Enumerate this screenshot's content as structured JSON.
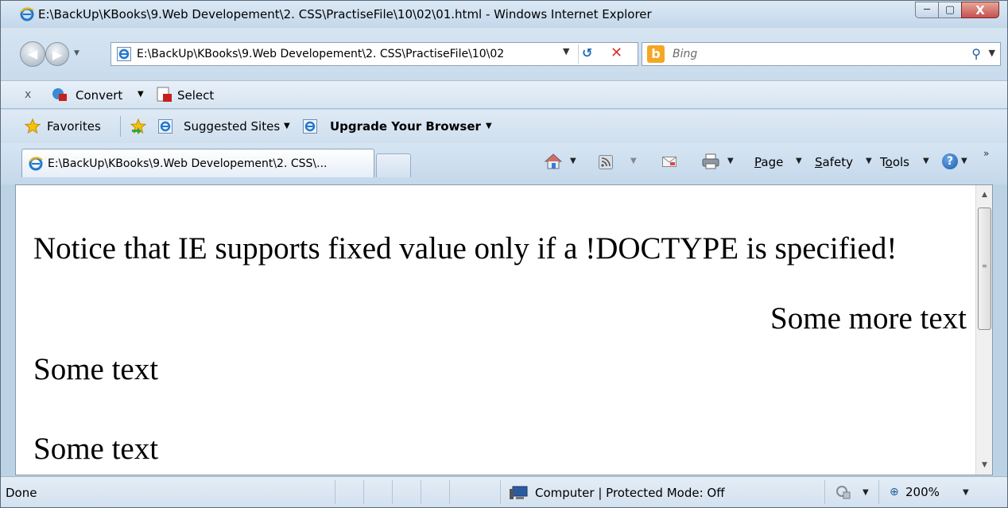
{
  "window": {
    "title": "E:\\BackUp\\KBooks\\9.Web Developement\\2. CSS\\PractiseFile\\10\\02\\01.html - Windows Internet Explorer",
    "minimize": "─",
    "maximize": "▢",
    "close": "X"
  },
  "nav": {
    "address": "E:\\BackUp\\KBooks\\9.Web Developement\\2. CSS\\PractiseFile\\10\\02",
    "search_placeholder": "Bing",
    "bing_logo": "b"
  },
  "command_bar": {
    "close": "x",
    "convert": "Convert",
    "select": "Select"
  },
  "favorites_bar": {
    "favorites": "Favorites",
    "suggested_sites": "Suggested Sites",
    "upgrade": "Upgrade Your Browser"
  },
  "tabs": {
    "active_tab": "E:\\BackUp\\KBooks\\9.Web Developement\\2. CSS\\..."
  },
  "toolbar": {
    "page_pre": "",
    "page_u": "P",
    "page_post": "age",
    "safety_u": "S",
    "safety_post": "afety",
    "tools_pre": "T",
    "tools_u": "o",
    "tools_post": "ols",
    "help": "?"
  },
  "page": {
    "notice": "Notice that IE supports fixed value only if a !DOCTYPE is specified!",
    "fixed_text": "Some more text",
    "text1": "Some text",
    "text2": "Some text"
  },
  "status": {
    "done": "Done",
    "zone": "Computer | Protected Mode: Off",
    "zoom": "200%"
  },
  "icons": {
    "ie": "ie-icon",
    "home": "home-icon",
    "rss": "rss-icon",
    "mail": "mail-icon",
    "print": "print-icon",
    "help": "help-icon"
  },
  "colors": {
    "frame": "#bcd3e6",
    "close_button": "#c75050",
    "bing": "#f5a623"
  }
}
